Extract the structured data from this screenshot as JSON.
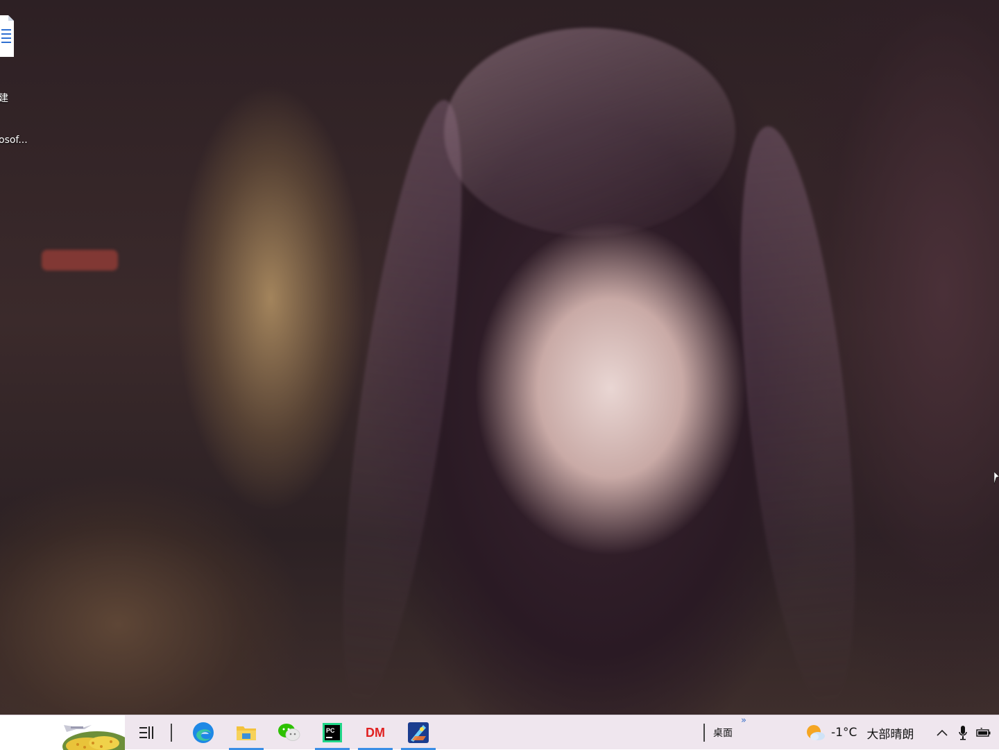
{
  "desktop": {
    "wallpaper": "portrait-wallpaper",
    "icons": [
      {
        "name": "document-icon",
        "label_line1": "建",
        "label_line2": "osof..."
      }
    ]
  },
  "taskbar": {
    "start": {
      "icon": "start-scenery-icon"
    },
    "task_view": {
      "icon": "task-view-icon"
    },
    "apps": [
      {
        "name": "edge",
        "icon": "edge-icon",
        "active": false
      },
      {
        "name": "file-explorer",
        "icon": "folder-icon",
        "active": true
      },
      {
        "name": "wechat",
        "icon": "wechat-icon",
        "active": false
      },
      {
        "name": "pycharm",
        "icon": "pycharm-icon",
        "label": "PC",
        "active": true
      },
      {
        "name": "dm",
        "icon": "dm-icon",
        "label": "DM",
        "active": true
      },
      {
        "name": "game",
        "icon": "game-icon",
        "active": true
      }
    ],
    "toolbar_label": "桌面",
    "toolbar_chevron": "»",
    "weather": {
      "icon": "partly-sunny-icon",
      "temperature": "-1°C",
      "description": "大部晴朗"
    },
    "tray": [
      {
        "icon": "chevron-up-icon"
      },
      {
        "icon": "microphone-icon"
      },
      {
        "icon": "battery-icon"
      }
    ],
    "colors": {
      "background": "#efe6ee",
      "active_underline": "#3a8ee6",
      "dm_red": "#e02020"
    }
  }
}
